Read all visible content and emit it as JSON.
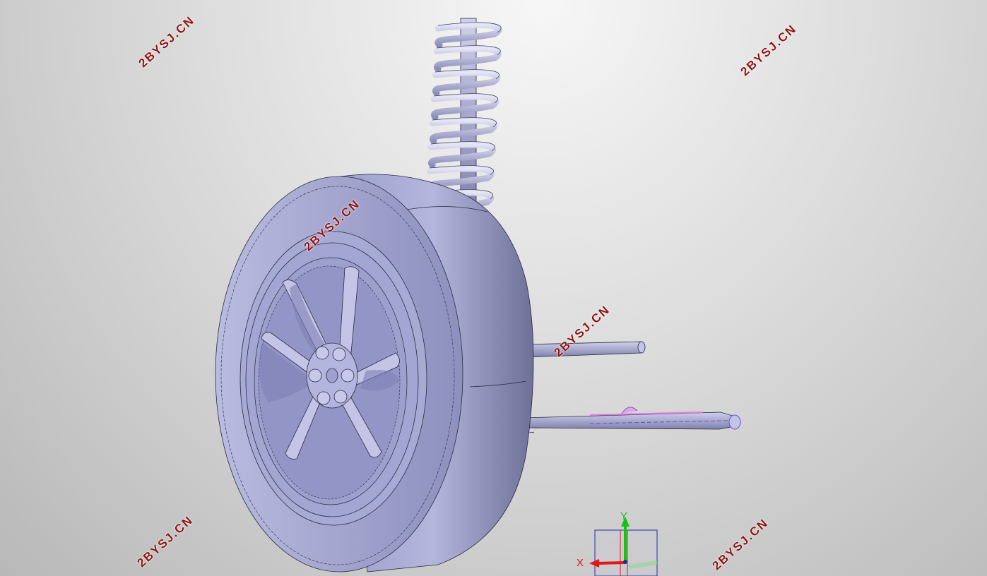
{
  "watermarks": [
    "2BYSJ.CN",
    "2BYSJ.CN",
    "2BYSJ.CN",
    "2BYSJ.CN",
    "2BYSJ.CN",
    "2BYSJ.CN"
  ],
  "triad": {
    "x_label": "X",
    "y_label": "Y",
    "x_color": "#e01818",
    "y_color": "#18c018"
  },
  "colors": {
    "model_fill": "#a6a8d4",
    "model_edge": "#2a2a40",
    "watermark": "#8e1414",
    "highlight": "#e07be0"
  },
  "icons": [
    "coordinate-triad-icon"
  ]
}
